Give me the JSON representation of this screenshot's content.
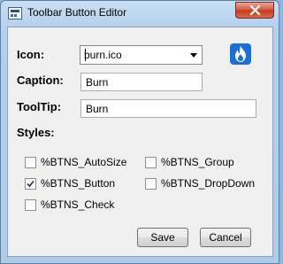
{
  "window": {
    "title": "Toolbar Button Editor"
  },
  "icon": {
    "label": "Icon:",
    "value": "burn.ico"
  },
  "caption": {
    "label": "Caption:",
    "value": "Burn"
  },
  "tooltip": {
    "label": "ToolTip:",
    "value": "Burn"
  },
  "styles": {
    "label": "Styles:",
    "items": [
      {
        "label": "%BTNS_AutoSize",
        "checked": false
      },
      {
        "label": "%BTNS_Group",
        "checked": false
      },
      {
        "label": "%BTNS_Button",
        "checked": true
      },
      {
        "label": "%BTNS_DropDown",
        "checked": false
      },
      {
        "label": "%BTNS_Check",
        "checked": false
      }
    ]
  },
  "buttons": {
    "save": "Save",
    "cancel": "Cancel"
  },
  "colors": {
    "icon_background": "#1e6ed8",
    "close_button": "#c2381f"
  }
}
